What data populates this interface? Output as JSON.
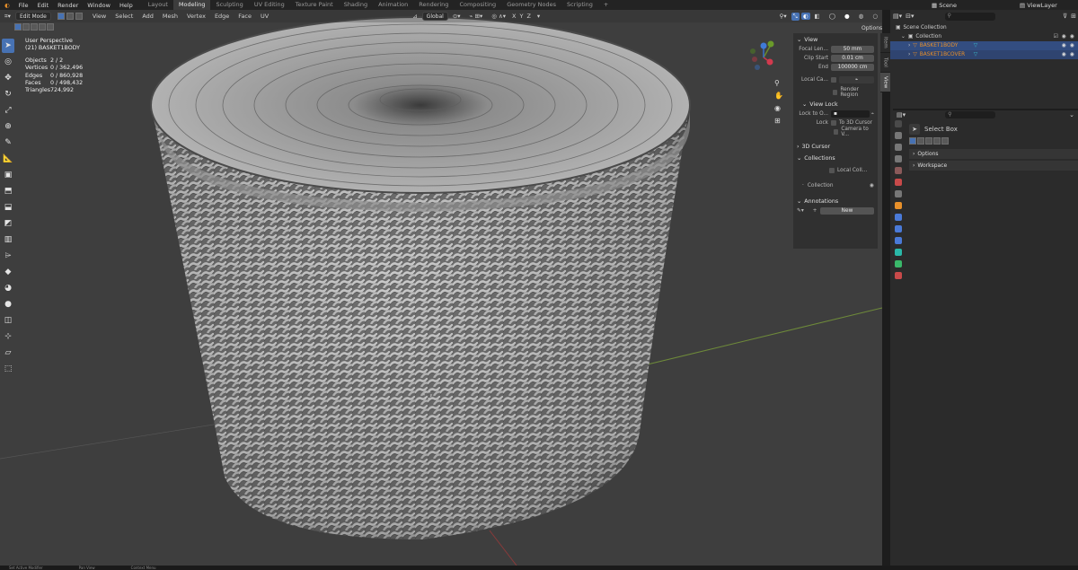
{
  "menu": [
    "File",
    "Edit",
    "Render",
    "Window",
    "Help"
  ],
  "workspaces": [
    "Layout",
    "Modeling",
    "Sculpting",
    "UV Editing",
    "Texture Paint",
    "Shading",
    "Animation",
    "Rendering",
    "Compositing",
    "Geometry Nodes",
    "Scripting"
  ],
  "active_workspace": "Modeling",
  "scene_label": "Scene",
  "viewlayer_label": "ViewLayer",
  "viewport": {
    "mode": "Edit Mode",
    "menu": [
      "View",
      "Select",
      "Add",
      "Mesh",
      "Vertex",
      "Edge",
      "Face",
      "UV"
    ],
    "transform_orientation": "Global",
    "options_label": "Options",
    "perspective": "User Perspective",
    "object_name": "(21) BASKET1BODY",
    "axes": [
      "X",
      "Y",
      "Z"
    ]
  },
  "stats": [
    {
      "label": "Objects",
      "value": "2 / 2"
    },
    {
      "label": "Vertices",
      "value": "0 / 362,496"
    },
    {
      "label": "Edges",
      "value": "0 / 860,928"
    },
    {
      "label": "Faces",
      "value": "0 / 498,432"
    },
    {
      "label": "Triangles",
      "value": "724,992"
    }
  ],
  "npanel": {
    "view_header": "View",
    "focal_label": "Focal Len...",
    "focal_value": "50 mm",
    "clipstart_label": "Clip Start",
    "clipstart_value": "0.01 cm",
    "end_label": "End",
    "end_value": "100000 cm",
    "localcam_label": "Local Ca...",
    "render_region": "Render Region",
    "viewlock_header": "View Lock",
    "lockto_label": "Lock to O...",
    "lock_label": "Lock",
    "to3dcursor": "To 3D Cursor",
    "cameratoview": "Camera to V...",
    "cursor_header": "3D Cursor",
    "collections_header": "Collections",
    "localcoll": "Local Coll...",
    "collection_label": "Collection",
    "annotations_header": "Annotations",
    "new_label": "New",
    "tabs": [
      "Item",
      "Tool",
      "View"
    ],
    "active_tab": "View"
  },
  "outliner": {
    "scene_collection": "Scene Collection",
    "collection": "Collection",
    "objects": [
      "BASKET1BODY",
      "BASKET1BCOVER"
    ]
  },
  "properties": {
    "tool_label": "Select Box",
    "sections": [
      "Options",
      "Workspace"
    ]
  },
  "status": [
    "Set Active Modifier",
    "Pan View",
    "Context Menu"
  ],
  "colors": {
    "accent": "#4772b3",
    "object_orange": "#e8902a",
    "viewport_bg": "#3e3e3e",
    "basket": "#9b9b9b"
  }
}
